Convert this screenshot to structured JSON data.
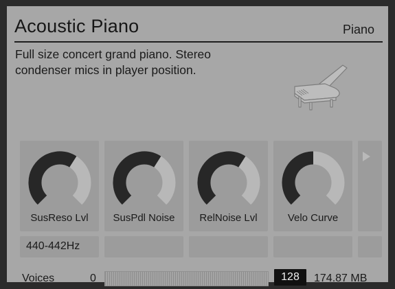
{
  "instrument": {
    "name": "Acoustic Piano",
    "category": "Piano",
    "description": "Full size concert grand piano. Stereo condenser mics in player position."
  },
  "icons": {
    "piano": "grand-piano-icon",
    "scroll": "play-arrow-icon"
  },
  "knobs": [
    {
      "label": "SusReso Lvl",
      "value": 0.62
    },
    {
      "label": "SusPdl Noise",
      "value": 0.62
    },
    {
      "label": "RelNoise Lvl",
      "value": 0.62
    },
    {
      "label": "Velo Curve",
      "value": 0.5
    }
  ],
  "bottom_fields": [
    {
      "text": "440-442Hz"
    },
    {
      "text": ""
    },
    {
      "text": ""
    },
    {
      "text": ""
    },
    {
      "text": ""
    }
  ],
  "status": {
    "voices_label": "Voices",
    "voices_min": "0",
    "voices_max": "128",
    "memory": "174.87 MB"
  },
  "colors": {
    "panel": "#a7a7a7",
    "tile": "#9c9c9c",
    "knob_value": "#272727",
    "knob_track": "#b8b8b8"
  }
}
